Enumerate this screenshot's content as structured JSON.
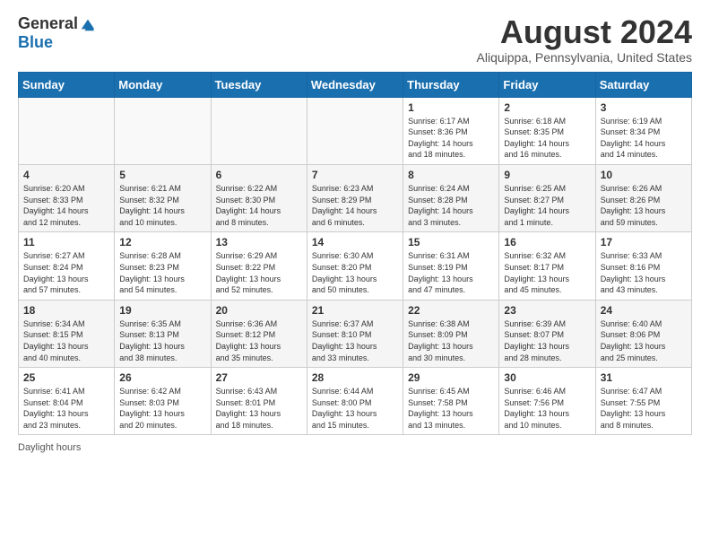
{
  "logo": {
    "general": "General",
    "blue": "Blue"
  },
  "title": "August 2024",
  "subtitle": "Aliquippa, Pennsylvania, United States",
  "days_of_week": [
    "Sunday",
    "Monday",
    "Tuesday",
    "Wednesday",
    "Thursday",
    "Friday",
    "Saturday"
  ],
  "footer_label": "Daylight hours",
  "weeks": [
    [
      {
        "day": "",
        "info": ""
      },
      {
        "day": "",
        "info": ""
      },
      {
        "day": "",
        "info": ""
      },
      {
        "day": "",
        "info": ""
      },
      {
        "day": "1",
        "info": "Sunrise: 6:17 AM\nSunset: 8:36 PM\nDaylight: 14 hours\nand 18 minutes."
      },
      {
        "day": "2",
        "info": "Sunrise: 6:18 AM\nSunset: 8:35 PM\nDaylight: 14 hours\nand 16 minutes."
      },
      {
        "day": "3",
        "info": "Sunrise: 6:19 AM\nSunset: 8:34 PM\nDaylight: 14 hours\nand 14 minutes."
      }
    ],
    [
      {
        "day": "4",
        "info": "Sunrise: 6:20 AM\nSunset: 8:33 PM\nDaylight: 14 hours\nand 12 minutes."
      },
      {
        "day": "5",
        "info": "Sunrise: 6:21 AM\nSunset: 8:32 PM\nDaylight: 14 hours\nand 10 minutes."
      },
      {
        "day": "6",
        "info": "Sunrise: 6:22 AM\nSunset: 8:30 PM\nDaylight: 14 hours\nand 8 minutes."
      },
      {
        "day": "7",
        "info": "Sunrise: 6:23 AM\nSunset: 8:29 PM\nDaylight: 14 hours\nand 6 minutes."
      },
      {
        "day": "8",
        "info": "Sunrise: 6:24 AM\nSunset: 8:28 PM\nDaylight: 14 hours\nand 3 minutes."
      },
      {
        "day": "9",
        "info": "Sunrise: 6:25 AM\nSunset: 8:27 PM\nDaylight: 14 hours\nand 1 minute."
      },
      {
        "day": "10",
        "info": "Sunrise: 6:26 AM\nSunset: 8:26 PM\nDaylight: 13 hours\nand 59 minutes."
      }
    ],
    [
      {
        "day": "11",
        "info": "Sunrise: 6:27 AM\nSunset: 8:24 PM\nDaylight: 13 hours\nand 57 minutes."
      },
      {
        "day": "12",
        "info": "Sunrise: 6:28 AM\nSunset: 8:23 PM\nDaylight: 13 hours\nand 54 minutes."
      },
      {
        "day": "13",
        "info": "Sunrise: 6:29 AM\nSunset: 8:22 PM\nDaylight: 13 hours\nand 52 minutes."
      },
      {
        "day": "14",
        "info": "Sunrise: 6:30 AM\nSunset: 8:20 PM\nDaylight: 13 hours\nand 50 minutes."
      },
      {
        "day": "15",
        "info": "Sunrise: 6:31 AM\nSunset: 8:19 PM\nDaylight: 13 hours\nand 47 minutes."
      },
      {
        "day": "16",
        "info": "Sunrise: 6:32 AM\nSunset: 8:17 PM\nDaylight: 13 hours\nand 45 minutes."
      },
      {
        "day": "17",
        "info": "Sunrise: 6:33 AM\nSunset: 8:16 PM\nDaylight: 13 hours\nand 43 minutes."
      }
    ],
    [
      {
        "day": "18",
        "info": "Sunrise: 6:34 AM\nSunset: 8:15 PM\nDaylight: 13 hours\nand 40 minutes."
      },
      {
        "day": "19",
        "info": "Sunrise: 6:35 AM\nSunset: 8:13 PM\nDaylight: 13 hours\nand 38 minutes."
      },
      {
        "day": "20",
        "info": "Sunrise: 6:36 AM\nSunset: 8:12 PM\nDaylight: 13 hours\nand 35 minutes."
      },
      {
        "day": "21",
        "info": "Sunrise: 6:37 AM\nSunset: 8:10 PM\nDaylight: 13 hours\nand 33 minutes."
      },
      {
        "day": "22",
        "info": "Sunrise: 6:38 AM\nSunset: 8:09 PM\nDaylight: 13 hours\nand 30 minutes."
      },
      {
        "day": "23",
        "info": "Sunrise: 6:39 AM\nSunset: 8:07 PM\nDaylight: 13 hours\nand 28 minutes."
      },
      {
        "day": "24",
        "info": "Sunrise: 6:40 AM\nSunset: 8:06 PM\nDaylight: 13 hours\nand 25 minutes."
      }
    ],
    [
      {
        "day": "25",
        "info": "Sunrise: 6:41 AM\nSunset: 8:04 PM\nDaylight: 13 hours\nand 23 minutes."
      },
      {
        "day": "26",
        "info": "Sunrise: 6:42 AM\nSunset: 8:03 PM\nDaylight: 13 hours\nand 20 minutes."
      },
      {
        "day": "27",
        "info": "Sunrise: 6:43 AM\nSunset: 8:01 PM\nDaylight: 13 hours\nand 18 minutes."
      },
      {
        "day": "28",
        "info": "Sunrise: 6:44 AM\nSunset: 8:00 PM\nDaylight: 13 hours\nand 15 minutes."
      },
      {
        "day": "29",
        "info": "Sunrise: 6:45 AM\nSunset: 7:58 PM\nDaylight: 13 hours\nand 13 minutes."
      },
      {
        "day": "30",
        "info": "Sunrise: 6:46 AM\nSunset: 7:56 PM\nDaylight: 13 hours\nand 10 minutes."
      },
      {
        "day": "31",
        "info": "Sunrise: 6:47 AM\nSunset: 7:55 PM\nDaylight: 13 hours\nand 8 minutes."
      }
    ]
  ]
}
